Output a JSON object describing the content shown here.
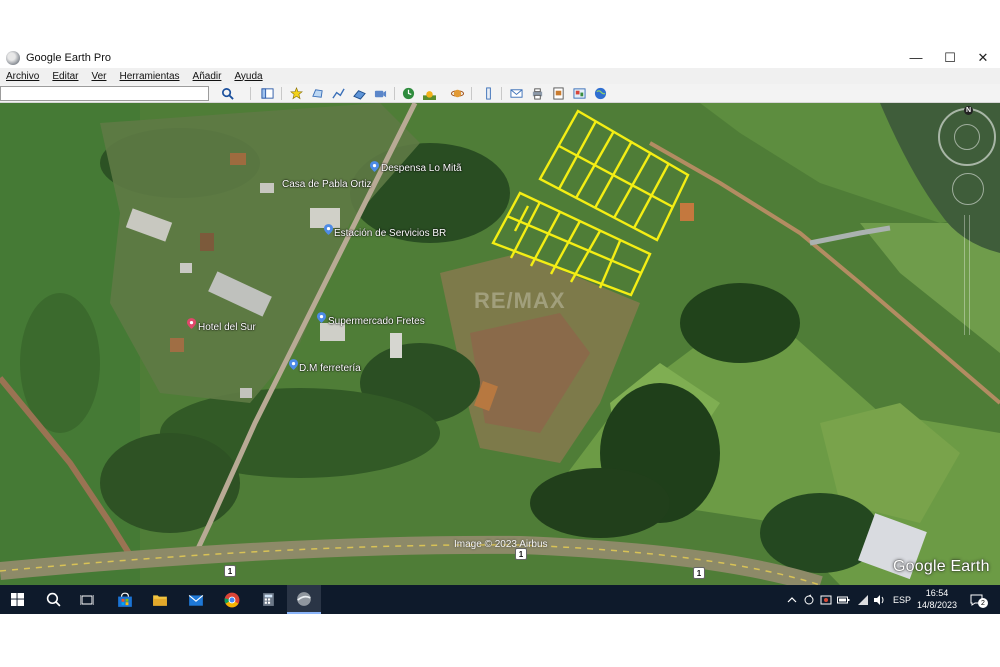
{
  "window": {
    "title": "Google Earth Pro",
    "controls": {
      "minimize": "—",
      "maximize": "☐",
      "close": "✕"
    }
  },
  "menu": {
    "items": [
      "Archivo",
      "Editar",
      "Ver",
      "Herramientas",
      "Añadir",
      "Ayuda"
    ]
  },
  "search": {
    "value": "",
    "placeholder": ""
  },
  "toolbar": {
    "icons": [
      "search-icon",
      "sidebar-toggle-icon",
      "add-placemark-icon",
      "add-polygon-icon",
      "add-path-icon",
      "add-image-overlay-icon",
      "record-tour-icon",
      "historical-imagery-icon",
      "sunlight-icon",
      "planets-icon",
      "ruler-icon",
      "email-icon",
      "print-icon",
      "save-image-icon",
      "view-in-maps-icon",
      "earth-icon"
    ]
  },
  "map": {
    "places": [
      {
        "label": "Despensa Lo Mitã",
        "type": "shop"
      },
      {
        "label": "Casa de Pabla Ortiz",
        "type": "place"
      },
      {
        "label": "Estación de Servicios BR",
        "type": "gas"
      },
      {
        "label": "Supermercado Fretes",
        "type": "shop"
      },
      {
        "label": "Hotel del Sur",
        "type": "hotel"
      },
      {
        "label": "D.M ferretería",
        "type": "shop"
      }
    ],
    "route_shields": [
      "1",
      "1",
      "1"
    ],
    "watermark": "RE/MAX",
    "attribution": "Image © 2023 Airbus",
    "brand": "Google Earth",
    "compass_north": "N",
    "highlight_color": "#f4ee14"
  },
  "taskbar": {
    "apps": [
      "windows-start-icon",
      "search-icon",
      "task-view-icon",
      "store-icon",
      "file-explorer-icon",
      "mail-icon",
      "chrome-icon",
      "calculator-icon",
      "google-earth-icon"
    ],
    "language": "ESP",
    "time": "16:54",
    "date": "14/8/2023",
    "notifications": "2"
  }
}
